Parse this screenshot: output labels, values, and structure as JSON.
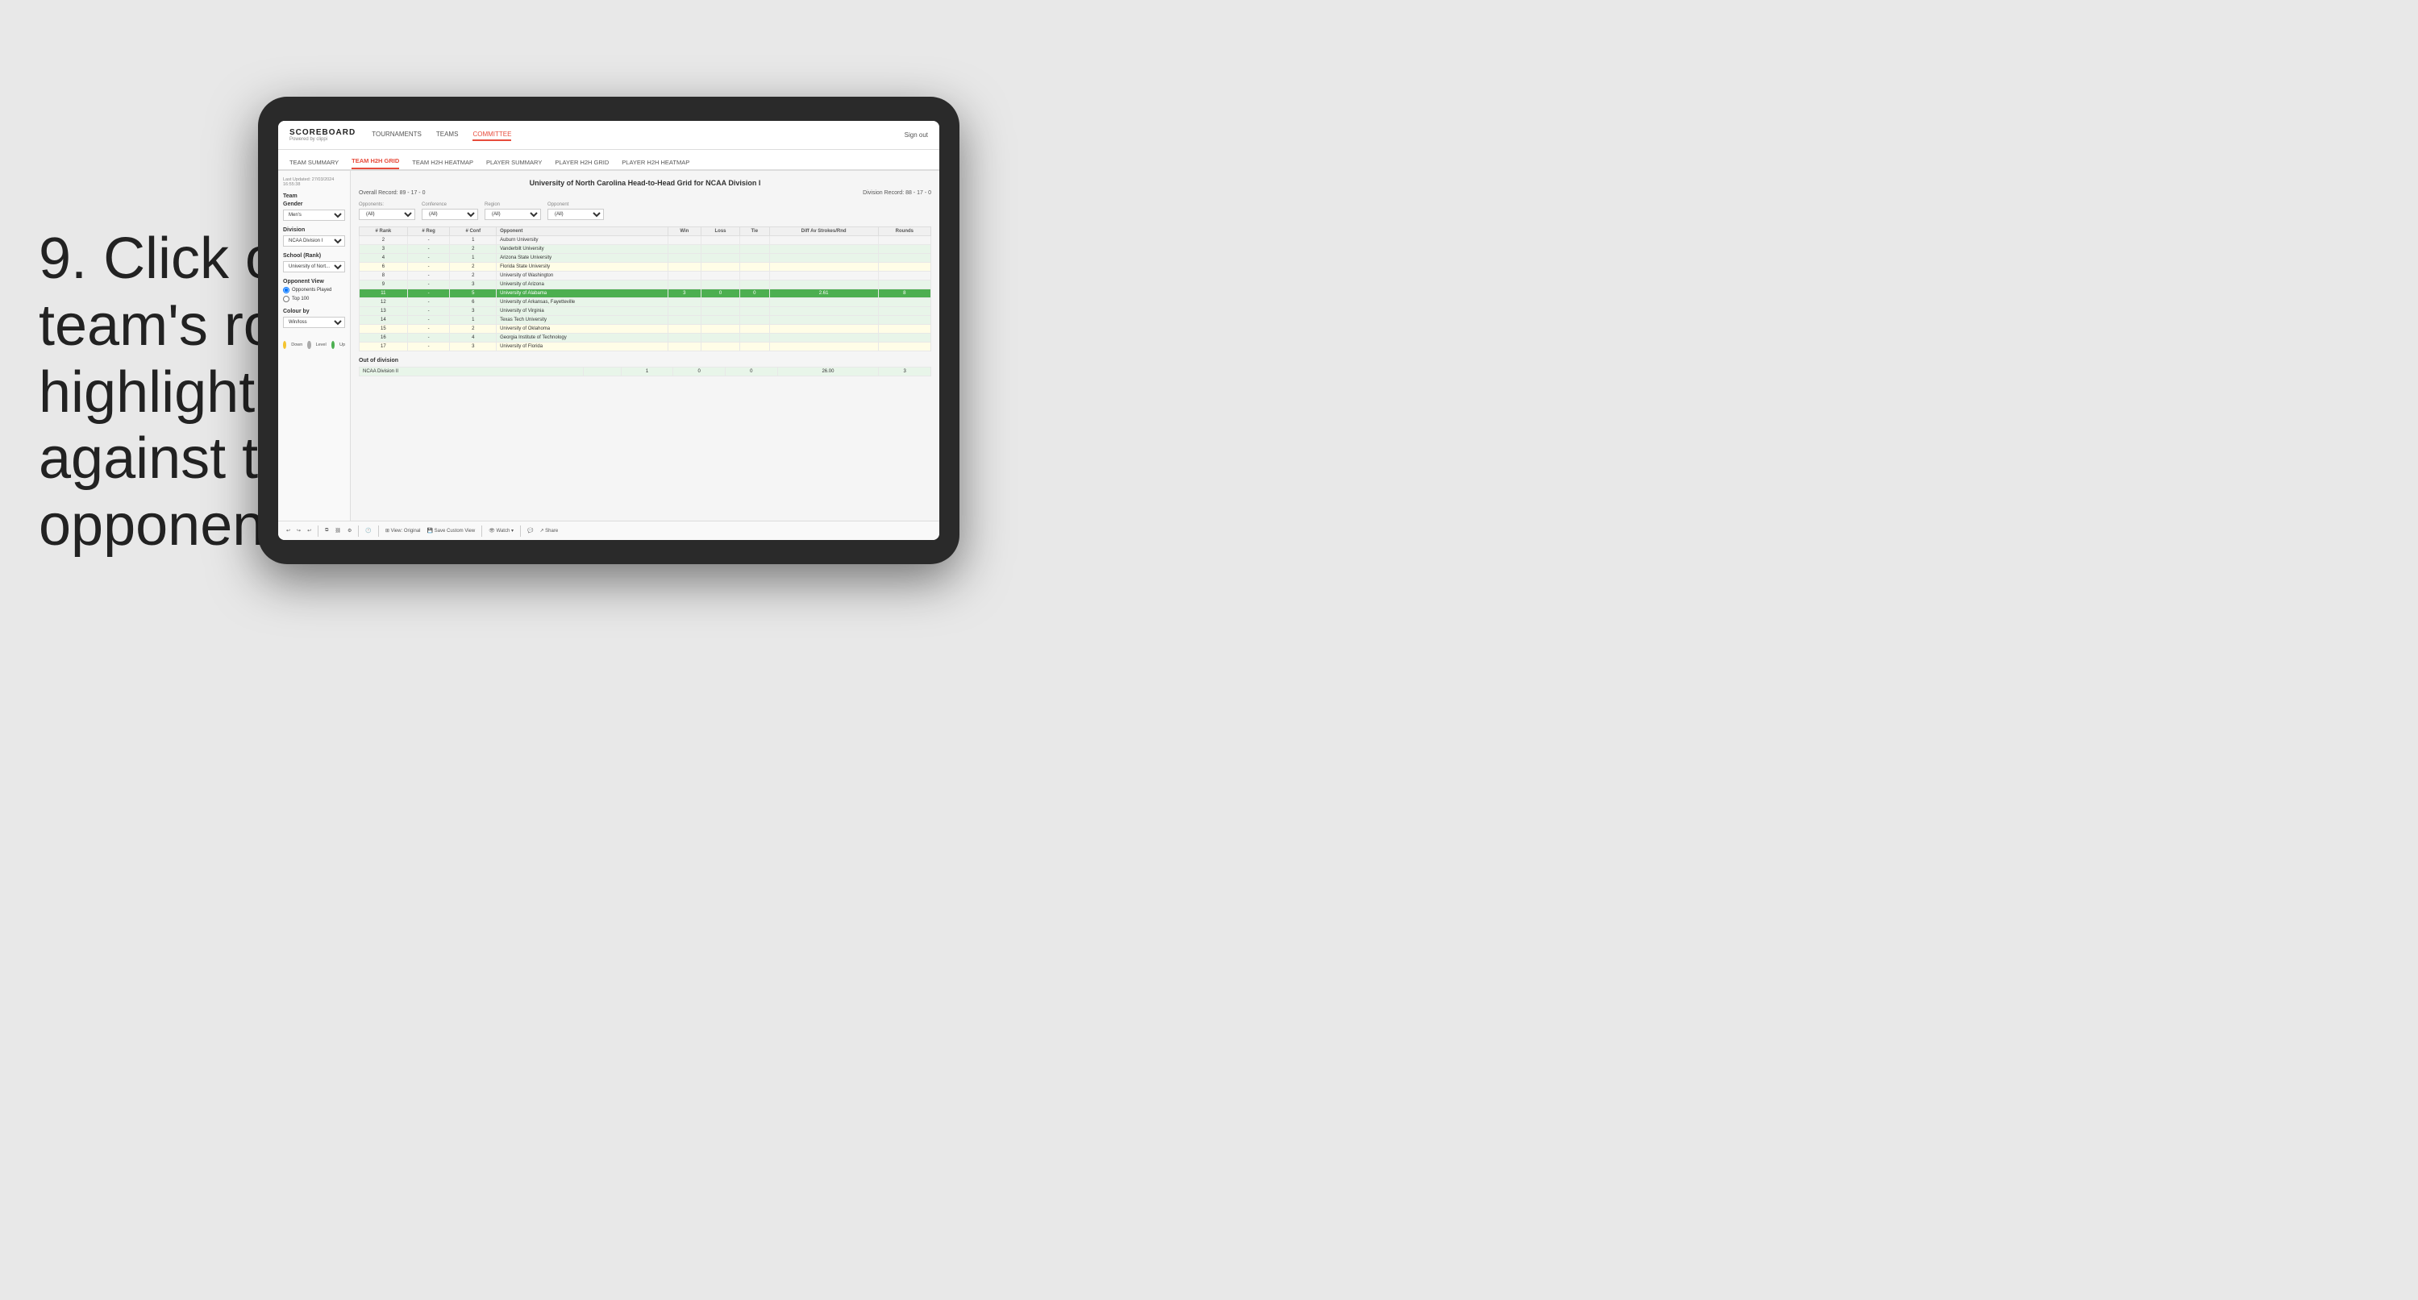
{
  "instruction": {
    "step": "9.",
    "text": "Click on a team's row to highlight results against that opponent"
  },
  "nav": {
    "logo_title": "SCOREBOARD",
    "logo_sub": "Powered by clippi",
    "items": [
      "TOURNAMENTS",
      "TEAMS",
      "COMMITTEE"
    ],
    "sign_out": "Sign out"
  },
  "sub_nav": {
    "items": [
      "TEAM SUMMARY",
      "TEAM H2H GRID",
      "TEAM H2H HEATMAP",
      "PLAYER SUMMARY",
      "PLAYER H2H GRID",
      "PLAYER H2H HEATMAP"
    ],
    "active": "TEAM H2H GRID"
  },
  "left_panel": {
    "last_updated": "Last Updated: 27/03/2024",
    "time": "16:55:38",
    "team_label": "Team",
    "gender_label": "Gender",
    "gender_value": "Men's",
    "division_label": "Division",
    "division_value": "NCAA Division I",
    "school_label": "School (Rank)",
    "school_value": "University of Nort...",
    "opponent_view_label": "Opponent View",
    "opponents_played": "Opponents Played",
    "top_100": "Top 100",
    "colour_by_label": "Colour by",
    "colour_by_value": "Win/loss",
    "legend": [
      {
        "color": "#f4c430",
        "label": "Down"
      },
      {
        "color": "#aaa",
        "label": "Level"
      },
      {
        "color": "#4caf50",
        "label": "Up"
      }
    ]
  },
  "grid": {
    "title": "University of North Carolina Head-to-Head Grid for NCAA Division I",
    "overall_record": "Overall Record: 89 - 17 - 0",
    "division_record": "Division Record: 88 - 17 - 0",
    "filters": {
      "opponents_label": "Opponents:",
      "opponents_value": "(All)",
      "conference_label": "Conference",
      "conference_value": "(All)",
      "region_label": "Region",
      "region_value": "(All)",
      "opponent_label": "Opponent",
      "opponent_value": "(All)"
    },
    "columns": [
      "# Rank",
      "# Reg",
      "# Conf",
      "Opponent",
      "Win",
      "Loss",
      "Tie",
      "Diff Av Strokes/Rnd",
      "Rounds"
    ],
    "rows": [
      {
        "rank": "2",
        "reg": "-",
        "conf": "1",
        "opponent": "Auburn University",
        "win": "",
        "loss": "",
        "tie": "",
        "diff": "",
        "rounds": "",
        "style": "normal"
      },
      {
        "rank": "3",
        "reg": "-",
        "conf": "2",
        "opponent": "Vanderbilt University",
        "win": "",
        "loss": "",
        "tie": "",
        "diff": "",
        "rounds": "",
        "style": "light-green"
      },
      {
        "rank": "4",
        "reg": "-",
        "conf": "1",
        "opponent": "Arizona State University",
        "win": "",
        "loss": "",
        "tie": "",
        "diff": "",
        "rounds": "",
        "style": "light-green"
      },
      {
        "rank": "6",
        "reg": "-",
        "conf": "2",
        "opponent": "Florida State University",
        "win": "",
        "loss": "",
        "tie": "",
        "diff": "",
        "rounds": "",
        "style": "light-yellow"
      },
      {
        "rank": "8",
        "reg": "-",
        "conf": "2",
        "opponent": "University of Washington",
        "win": "",
        "loss": "",
        "tie": "",
        "diff": "",
        "rounds": "",
        "style": "normal"
      },
      {
        "rank": "9",
        "reg": "-",
        "conf": "3",
        "opponent": "University of Arizona",
        "win": "",
        "loss": "",
        "tie": "",
        "diff": "",
        "rounds": "",
        "style": "light-green"
      },
      {
        "rank": "11",
        "reg": "-",
        "conf": "5",
        "opponent": "University of Alabama",
        "win": "3",
        "loss": "0",
        "tie": "0",
        "diff": "2.61",
        "rounds": "8",
        "style": "highlighted"
      },
      {
        "rank": "12",
        "reg": "-",
        "conf": "6",
        "opponent": "University of Arkansas, Fayetteville",
        "win": "",
        "loss": "",
        "tie": "",
        "diff": "",
        "rounds": "",
        "style": "light-green"
      },
      {
        "rank": "13",
        "reg": "-",
        "conf": "3",
        "opponent": "University of Virginia",
        "win": "",
        "loss": "",
        "tie": "",
        "diff": "",
        "rounds": "",
        "style": "light-green"
      },
      {
        "rank": "14",
        "reg": "-",
        "conf": "1",
        "opponent": "Texas Tech University",
        "win": "",
        "loss": "",
        "tie": "",
        "diff": "",
        "rounds": "",
        "style": "light-green"
      },
      {
        "rank": "15",
        "reg": "-",
        "conf": "2",
        "opponent": "University of Oklahoma",
        "win": "",
        "loss": "",
        "tie": "",
        "diff": "",
        "rounds": "",
        "style": "light-yellow"
      },
      {
        "rank": "16",
        "reg": "-",
        "conf": "4",
        "opponent": "Georgia Institute of Technology",
        "win": "",
        "loss": "",
        "tie": "",
        "diff": "",
        "rounds": "",
        "style": "light-green"
      },
      {
        "rank": "17",
        "reg": "-",
        "conf": "3",
        "opponent": "University of Florida",
        "win": "",
        "loss": "",
        "tie": "",
        "diff": "",
        "rounds": "",
        "style": "light-yellow"
      }
    ],
    "out_of_division_label": "Out of division",
    "out_of_division_rows": [
      {
        "division": "NCAA Division II",
        "win": "1",
        "loss": "0",
        "tie": "0",
        "diff": "26.00",
        "rounds": "3"
      }
    ]
  },
  "toolbar": {
    "buttons": [
      "View: Original",
      "Save Custom View",
      "Watch ▾",
      "Share"
    ]
  }
}
